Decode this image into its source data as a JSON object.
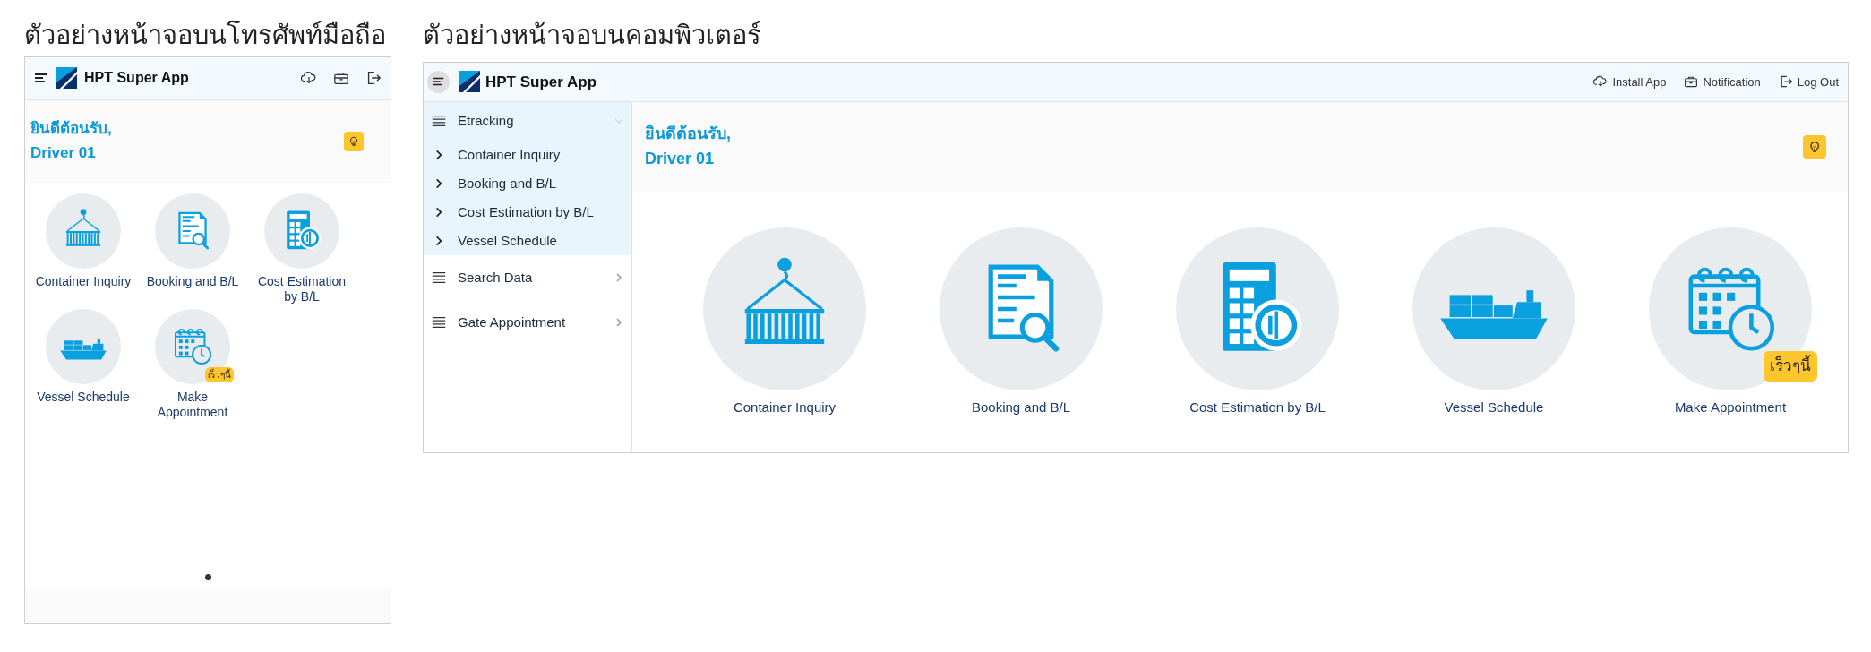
{
  "mobile": {
    "caption": "ตัวอย่างหน้าจอบนโทรศัพท์มือถือ",
    "app_title": "HPT Super App",
    "welcome": {
      "greeting": "ยินดีต้อนรับ,",
      "user": "Driver 01"
    },
    "tiles": [
      {
        "label": "Container Inquiry"
      },
      {
        "label": "Booking and B/L"
      },
      {
        "label": "Cost Estimation by B/L"
      },
      {
        "label": "Vessel Schedule"
      },
      {
        "label": "Make Appointment",
        "badge": "เร็วๆนี้"
      }
    ]
  },
  "desktop": {
    "caption": "ตัวอย่างหน้าจอบนคอมพิวเตอร์",
    "app_title": "HPT Super App",
    "actions": [
      {
        "label": "Install App"
      },
      {
        "label": "Notification"
      },
      {
        "label": "Log Out"
      }
    ],
    "sidebar": {
      "items": [
        {
          "label": "Etracking",
          "expanded": true,
          "children": [
            {
              "label": "Container Inquiry"
            },
            {
              "label": "Booking and B/L"
            },
            {
              "label": "Cost Estimation by B/L"
            },
            {
              "label": "Vessel Schedule"
            }
          ]
        },
        {
          "label": "Search Data",
          "expanded": false
        },
        {
          "label": "Gate Appointment",
          "expanded": false
        }
      ]
    },
    "welcome": {
      "greeting": "ยินดีต้อนรับ,",
      "user": "Driver 01"
    },
    "tiles": [
      {
        "label": "Container Inquiry"
      },
      {
        "label": "Booking and B/L"
      },
      {
        "label": "Cost Estimation by B/L"
      },
      {
        "label": "Vessel Schedule"
      },
      {
        "label": "Make Appointment",
        "badge": "เร็วๆนี้"
      }
    ]
  }
}
